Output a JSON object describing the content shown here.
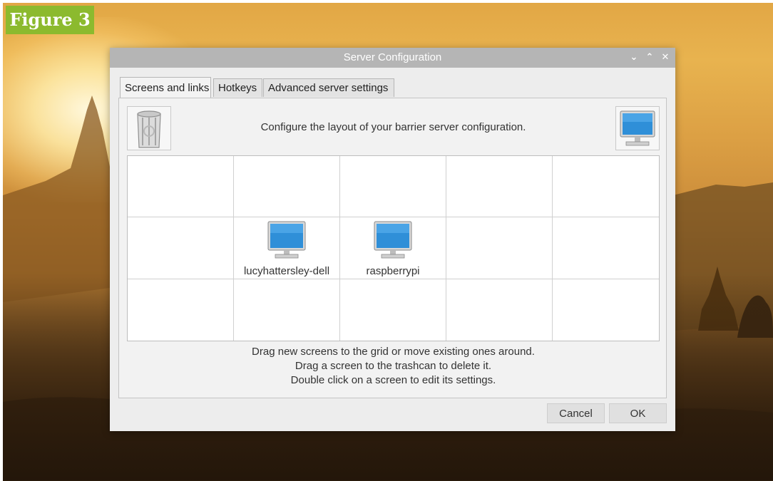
{
  "figure_label": "Figure 3",
  "window": {
    "title": "Server Configuration",
    "controls": [
      "minimize",
      "maximize",
      "close"
    ]
  },
  "tabs": [
    {
      "label": "Screens and links",
      "active": true
    },
    {
      "label": "Hotkeys",
      "active": false
    },
    {
      "label": "Advanced server settings",
      "active": false
    }
  ],
  "panel": {
    "header_text": "Configure the layout of your barrier server configuration.",
    "left_icon": "trashcan-icon",
    "right_icon": "new-screen-icon"
  },
  "grid": {
    "rows": 3,
    "columns": 5,
    "screens": [
      {
        "name": "lucyhattersley-dell",
        "row": 2,
        "column": 2
      },
      {
        "name": "raspberrypi",
        "row": 2,
        "column": 3
      }
    ]
  },
  "instructions": [
    "Drag new screens to the grid or move existing ones around.",
    "Drag a screen to the trashcan to delete it.",
    "Double click on a screen to edit its settings."
  ],
  "buttons": {
    "cancel": "Cancel",
    "ok": "OK"
  },
  "colors": {
    "figure_label_bg": "#8cba2e",
    "titlebar_bg": "#b5b5b5",
    "window_bg": "#ededed",
    "monitor_screen": "#2f8fd8"
  }
}
